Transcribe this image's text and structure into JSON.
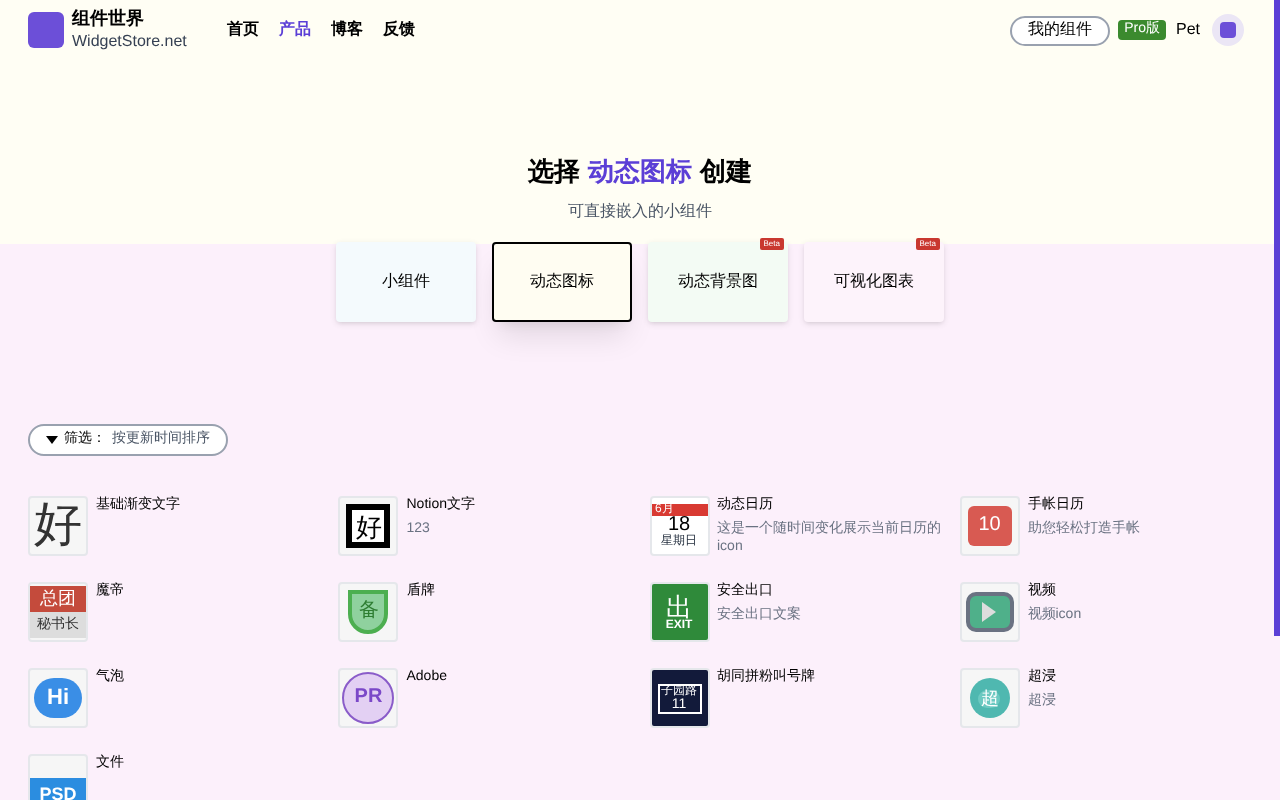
{
  "header": {
    "logo_title": "组件世界",
    "logo_subtitle": "WidgetStore.net",
    "nav": [
      {
        "label": "首页",
        "selected": false
      },
      {
        "label": "产品",
        "selected": true
      },
      {
        "label": "博客",
        "selected": false
      },
      {
        "label": "反馈",
        "selected": false
      }
    ],
    "my_widgets_button": "我的组件",
    "pro_badge": "Pro版",
    "user_name": "Pet"
  },
  "hero": {
    "title_before": "选择",
    "title_highlight": "动态图标",
    "title_after": "创建",
    "subtitle": "可直接嵌入的小组件"
  },
  "tabs": [
    {
      "label": "小组件",
      "selected": false
    },
    {
      "label": "动态图标",
      "selected": true
    },
    {
      "label": "动态背景图",
      "selected": false,
      "badge": "Beta"
    },
    {
      "label": "可视化图表",
      "selected": false,
      "badge": "Beta"
    }
  ],
  "filter": {
    "label": "筛选：",
    "value": "按更新时间排序"
  },
  "items": [
    {
      "title": "基础渐变文字",
      "icon": {
        "kind": "hanzi",
        "texts": [
          "好"
        ]
      }
    },
    {
      "title": "Notion文字",
      "desc": "123",
      "icon": {
        "kind": "cube",
        "texts": [
          "好"
        ]
      }
    },
    {
      "title": "动态日历",
      "desc": "这是一个随时间变化展示当前日历的icon",
      "icon": {
        "kind": "calendar",
        "texts": [
          "6月",
          "18",
          "星期日"
        ]
      }
    },
    {
      "title": "手帐日历",
      "desc": "助您轻松打造手帐",
      "icon": {
        "kind": "redcal",
        "texts": [
          "10"
        ]
      }
    },
    {
      "title": "魔帝",
      "icon": {
        "kind": "plaque",
        "texts": [
          "总团",
          "秘书长"
        ]
      }
    },
    {
      "title": "盾牌",
      "icon": {
        "kind": "shield",
        "texts": [
          "备"
        ]
      }
    },
    {
      "title": "安全出口",
      "desc": "安全出口文案",
      "icon": {
        "kind": "exit",
        "texts": [
          "出",
          "EXIT"
        ]
      }
    },
    {
      "title": "视频",
      "desc": "视频icon",
      "icon": {
        "kind": "play"
      }
    },
    {
      "title": "气泡",
      "icon": {
        "kind": "bubble",
        "texts": [
          "Hi"
        ]
      }
    },
    {
      "title": "Adobe",
      "icon": {
        "kind": "circle",
        "texts": [
          "PR"
        ]
      }
    },
    {
      "title": "胡同拼粉叫号牌",
      "icon": {
        "kind": "sign",
        "texts": [
          "子园路",
          "11"
        ]
      }
    },
    {
      "title": "超浸",
      "desc": "超浸",
      "icon": {
        "kind": "pin",
        "texts": [
          "超"
        ]
      }
    },
    {
      "title": "文件",
      "icon": {
        "kind": "file",
        "texts": [
          "PSD"
        ]
      }
    }
  ]
}
